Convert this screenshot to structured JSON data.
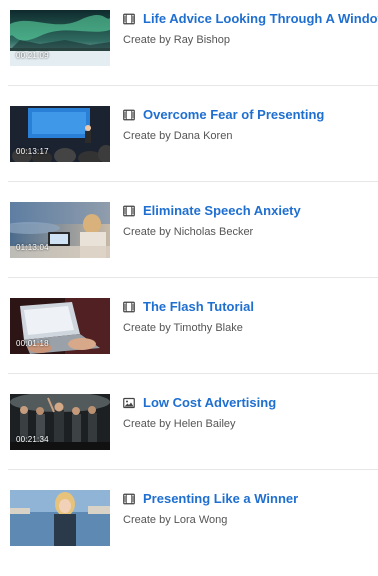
{
  "items": [
    {
      "title": "Life Advice Looking Through A Window",
      "author": "Create by Ray Bishop",
      "duration": "00:21:09",
      "type_icon": "film-icon"
    },
    {
      "title": "Overcome Fear of Presenting",
      "author": "Create by Dana Koren",
      "duration": "00:13:17",
      "type_icon": "film-icon"
    },
    {
      "title": "Eliminate Speech Anxiety",
      "author": "Create by Nicholas Becker",
      "duration": "01:13:04",
      "type_icon": "film-icon"
    },
    {
      "title": "The Flash Tutorial",
      "author": "Create by Timothy Blake",
      "duration": "00:01:18",
      "type_icon": "film-icon"
    },
    {
      "title": "Low Cost Advertising",
      "author": "Create by Helen Bailey",
      "duration": "00:21:34",
      "type_icon": "image-icon"
    },
    {
      "title": "Presenting Like a Winner",
      "author": "Create by Lora Wong",
      "duration": "",
      "type_icon": "film-icon"
    }
  ],
  "colors": {
    "title": "#1f6fd1",
    "author": "#555555",
    "divider": "#e6e6e6",
    "icon": "#444444"
  }
}
